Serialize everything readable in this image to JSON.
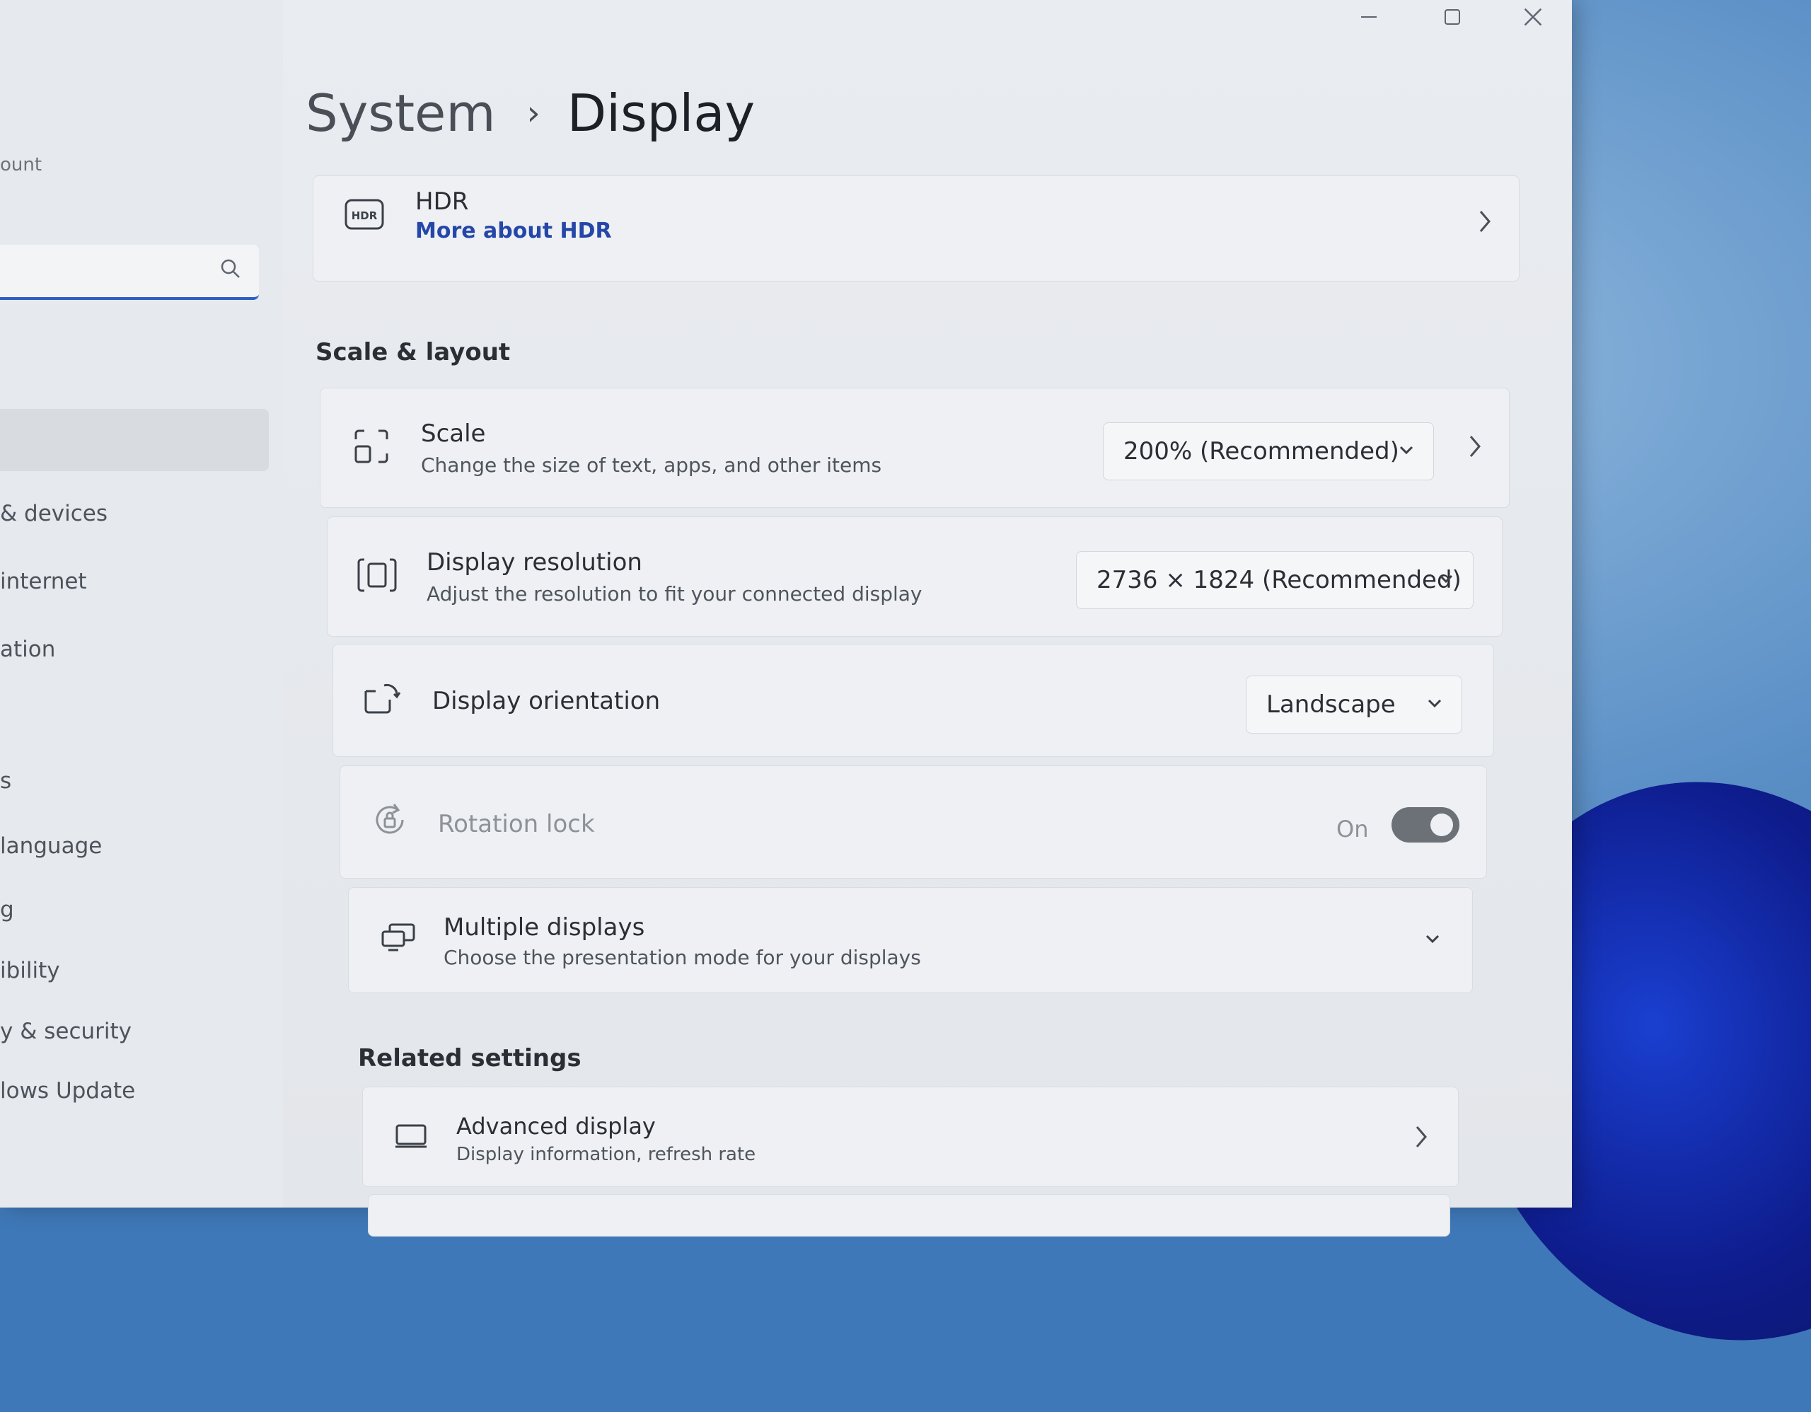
{
  "window": {
    "title_buttons": [
      "minimize-icon",
      "maximize-icon",
      "close-icon"
    ]
  },
  "sidebar": {
    "account_fragment": "ount",
    "search": {
      "value": "",
      "placeholder": ""
    },
    "items": [
      {
        "label": "& devices"
      },
      {
        "label": "internet"
      },
      {
        "label": "ation"
      },
      {
        "label": "s"
      },
      {
        "label": "language"
      },
      {
        "label": "g"
      },
      {
        "label": "ibility"
      },
      {
        "label": "y & security"
      },
      {
        "label": "lows Update"
      }
    ]
  },
  "breadcrumb": {
    "parent": "System",
    "separator": "›",
    "current": "Display"
  },
  "hdr": {
    "icon": "hdr-icon",
    "title": "HDR",
    "link": "More about HDR"
  },
  "scale_layout": {
    "section_title": "Scale & layout",
    "scale": {
      "icon": "scale-icon",
      "title": "Scale",
      "desc": "Change the size of text, apps, and other items",
      "value": "200% (Recommended)"
    },
    "resolution": {
      "icon": "resolution-icon",
      "title": "Display resolution",
      "desc": "Adjust the resolution to fit your connected display",
      "value": "2736 × 1824 (Recommended)"
    },
    "orientation": {
      "icon": "orientation-icon",
      "title": "Display orientation",
      "value": "Landscape"
    },
    "rotation_lock": {
      "icon": "rotation-lock-icon",
      "title": "Rotation lock",
      "state_label": "On",
      "enabled": false
    },
    "multiple_displays": {
      "icon": "multiple-displays-icon",
      "title": "Multiple displays",
      "desc": "Choose the presentation mode for your displays"
    }
  },
  "related": {
    "section_title": "Related settings",
    "advanced_display": {
      "icon": "monitor-icon",
      "title": "Advanced display",
      "desc": "Display information, refresh rate"
    }
  },
  "colors": {
    "accent": "#2d5fc7",
    "link": "#2547a8"
  }
}
